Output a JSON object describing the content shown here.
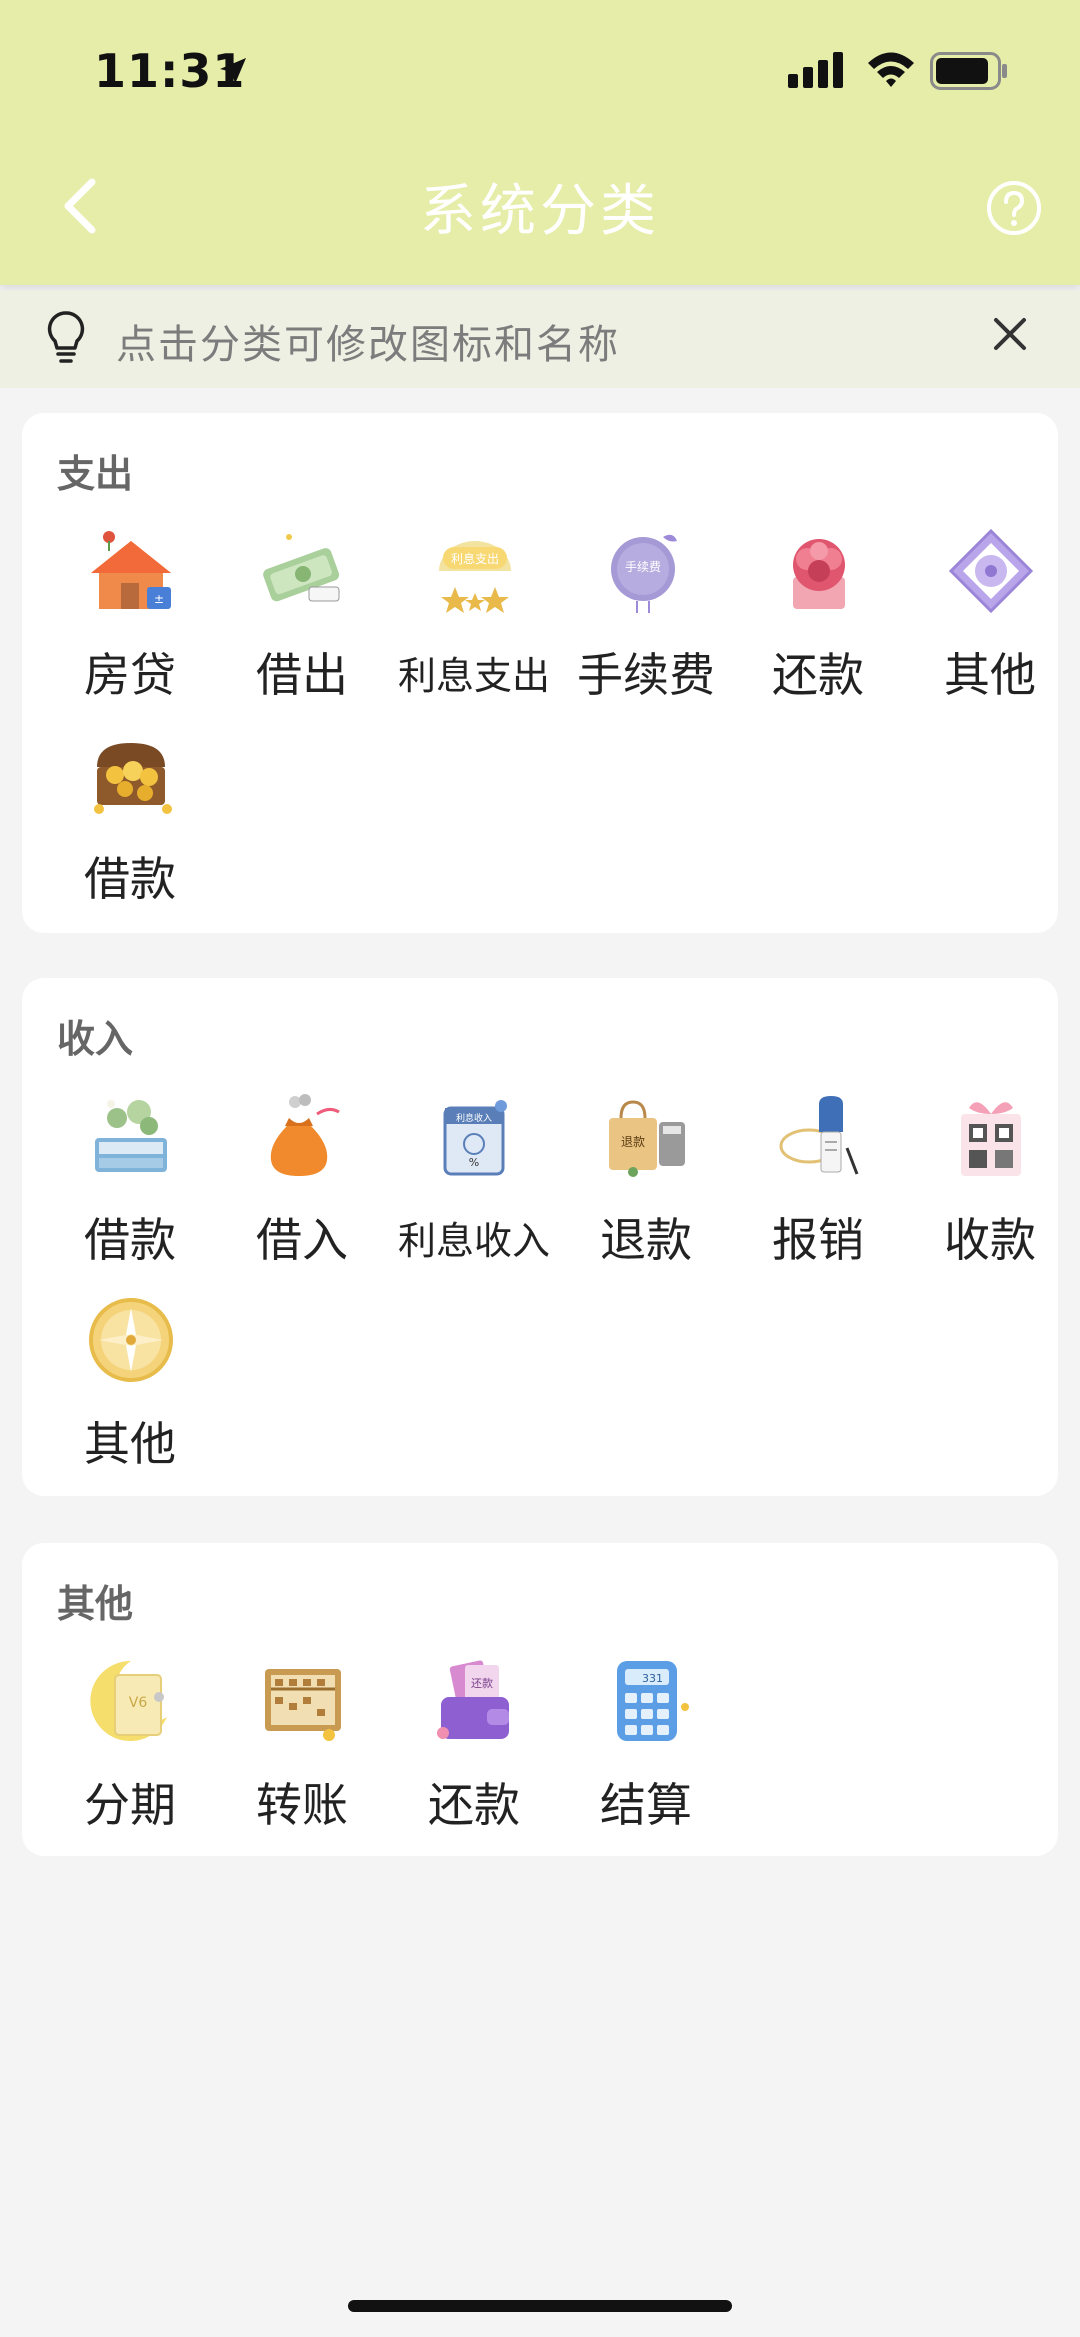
{
  "status": {
    "time": "11:31"
  },
  "header": {
    "title": "系统分类"
  },
  "tip": {
    "text": "点击分类可修改图标和名称"
  },
  "sections": [
    {
      "title": "支出",
      "items": [
        {
          "label": "房贷",
          "icon": "house-icon"
        },
        {
          "label": "借出",
          "icon": "money-roll-icon"
        },
        {
          "label": "利息支出",
          "icon": "interest-badge-icon"
        },
        {
          "label": "手续费",
          "icon": "fee-tag-icon"
        },
        {
          "label": "还款",
          "icon": "flower-gift-icon"
        },
        {
          "label": "其他",
          "icon": "diamond-icon"
        },
        {
          "label": "借款",
          "icon": "treasure-chest-icon"
        }
      ]
    },
    {
      "title": "收入",
      "items": [
        {
          "label": "借款",
          "icon": "book-plant-icon"
        },
        {
          "label": "借入",
          "icon": "money-bag-icon"
        },
        {
          "label": "利息收入",
          "icon": "calendar-percent-icon"
        },
        {
          "label": "退款",
          "icon": "shopping-bag-icon"
        },
        {
          "label": "报销",
          "icon": "mailbox-icon"
        },
        {
          "label": "收款",
          "icon": "qr-gift-icon"
        },
        {
          "label": "其他",
          "icon": "compass-icon"
        }
      ]
    },
    {
      "title": "其他",
      "items": [
        {
          "label": "分期",
          "icon": "moon-card-icon"
        },
        {
          "label": "转账",
          "icon": "abacus-icon"
        },
        {
          "label": "还款",
          "icon": "wallet-icon"
        },
        {
          "label": "结算",
          "icon": "calculator-icon"
        }
      ]
    }
  ],
  "icon_badges": {
    "interest": "利息支出",
    "fee": "手续费",
    "calendar": "利息收入",
    "refund": "退款",
    "repay": "还款",
    "calc_display": "331"
  }
}
